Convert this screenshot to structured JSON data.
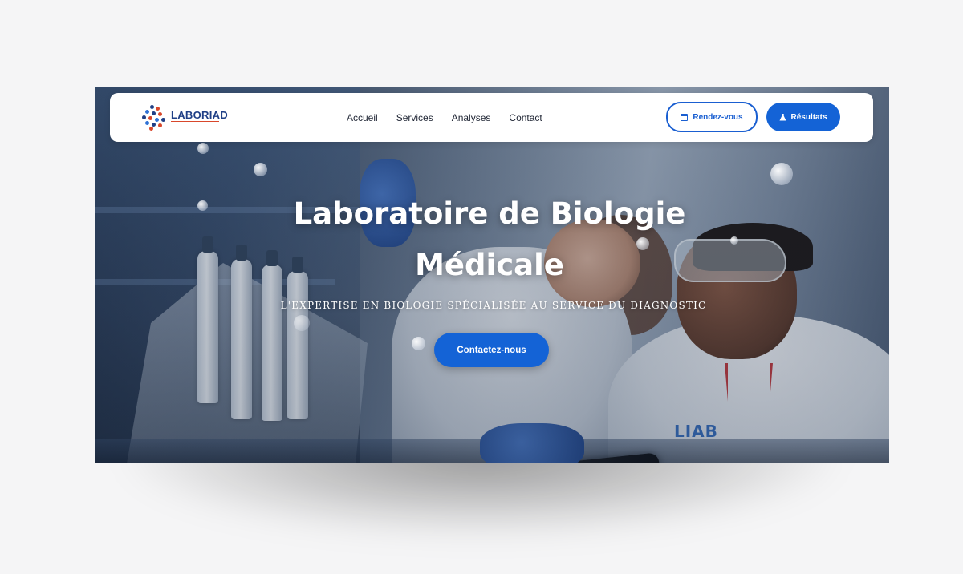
{
  "brand": {
    "name": "LABORIAD",
    "tagline": "",
    "colors": {
      "primary": "#1463d6",
      "navy": "#1f3f86",
      "accent": "#d9472b"
    }
  },
  "nav": {
    "links": [
      "Accueil",
      "Services",
      "Analyses",
      "Contact"
    ],
    "appointment_button": {
      "label": "Rendez-vous",
      "icon": "calendar-icon"
    },
    "results_button": {
      "label": "Résultats",
      "icon": "flask-icon"
    }
  },
  "hero": {
    "title_line1": "Laboratoire de Biologie",
    "title_line2": "Médicale",
    "subtitle": "L'EXPERTISE EN BIOLOGIE SPÉCIALISÉE AU SERVICE DU DIAGNOSTIC",
    "cta_label": "Contactez-nous",
    "coat_logo": "LIAB"
  }
}
